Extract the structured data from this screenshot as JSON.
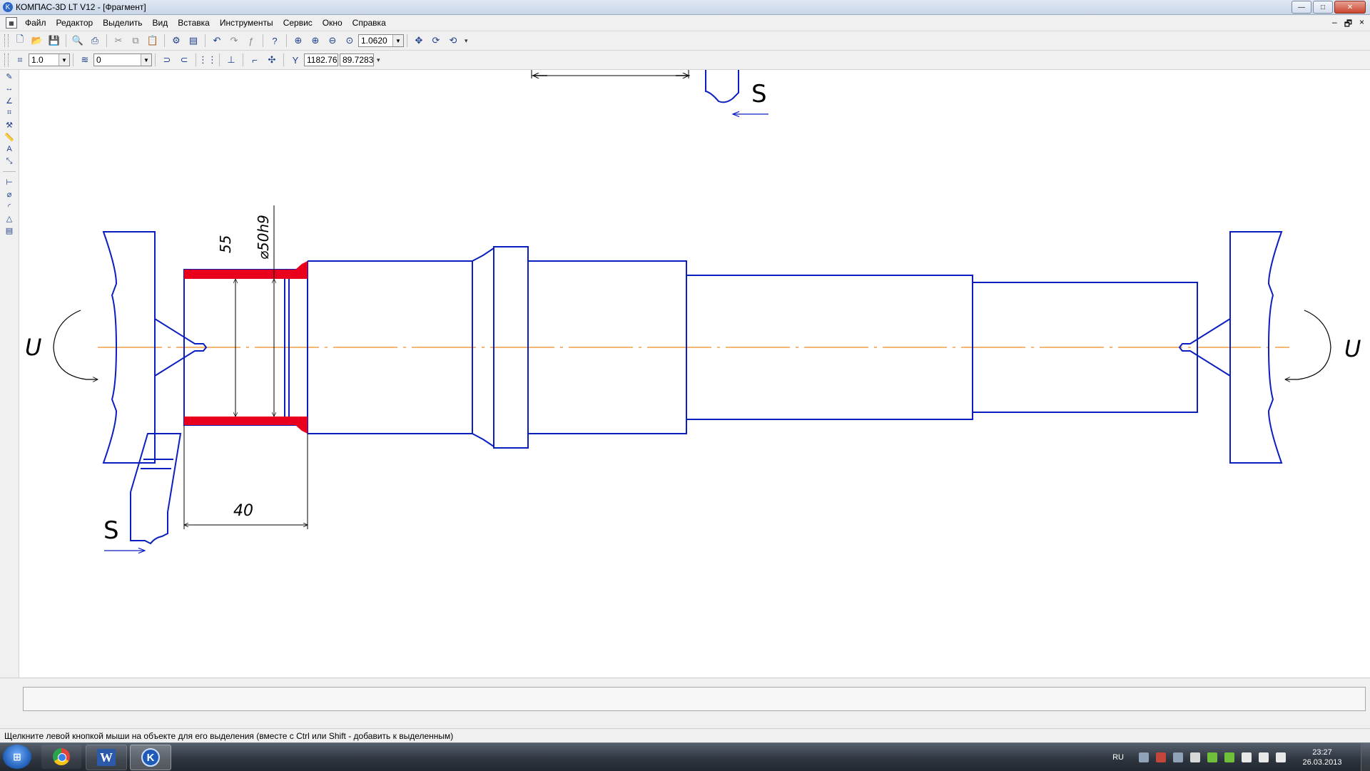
{
  "window": {
    "title": "КОМПАС-3D LT V12 - [Фрагмент]",
    "controls": {
      "minimize": "—",
      "maximize": "□",
      "close": "✕"
    }
  },
  "menu": {
    "items": [
      "Файл",
      "Редактор",
      "Выделить",
      "Вид",
      "Вставка",
      "Инструменты",
      "Сервис",
      "Окно",
      "Справка"
    ],
    "mdi_controls": {
      "minimize": "–",
      "restore": "🗗",
      "close": "×"
    }
  },
  "toolbar1": {
    "zoom_value": "1.0620"
  },
  "toolbar2": {
    "step_value": "1.0",
    "layer_value": "0",
    "coord_x": "1182.76",
    "coord_y": "89.7283"
  },
  "drawing": {
    "dim_length": "40",
    "dim_depth": "55",
    "dim_diameter": "⌀50h9",
    "label_s_top": "S",
    "label_s_bottom": "S",
    "label_u_left": "U",
    "label_u_right": "U",
    "colors": {
      "outline": "#0b1fc0",
      "axis": "#f08a1e",
      "machined": "#e8001c",
      "dim": "#000000"
    }
  },
  "status": {
    "text": "Щелкните левой кнопкой мыши на объекте для его выделения (вместе с Ctrl или Shift - добавить к выделенным)"
  },
  "taskbar": {
    "language": "RU",
    "time": "23:27",
    "date": "26.03.2013",
    "apps": [
      {
        "name": "chrome",
        "icon": "chrome-icon"
      },
      {
        "name": "word",
        "icon": "word-icon",
        "label": "W"
      },
      {
        "name": "kompas",
        "icon": "kompas-icon",
        "label": "K"
      }
    ]
  }
}
